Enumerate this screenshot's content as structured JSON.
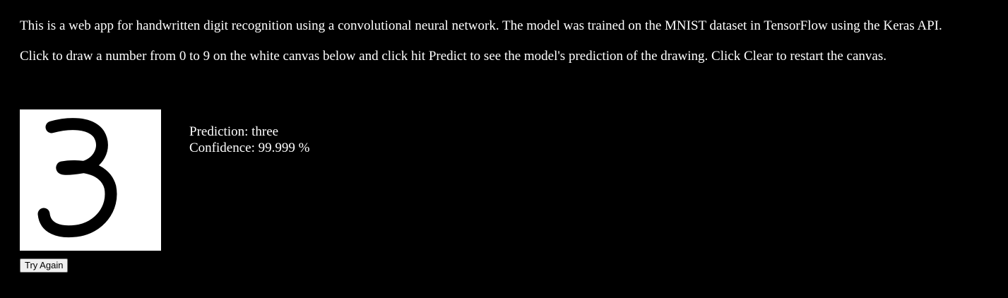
{
  "intro": {
    "line1": "This is a web app for handwritten digit recognition using a convolutional neural network. The model was trained on the MNIST dataset in TensorFlow using the Keras API.",
    "line2": "Click to draw a number from 0 to 9 on the white canvas below and click hit Predict to see the model's prediction of the drawing. Click Clear to restart the canvas."
  },
  "canvas": {
    "background": "#ffffff",
    "stroke_color": "#000000"
  },
  "prediction": {
    "label": "Prediction:",
    "value": "three"
  },
  "confidence": {
    "label": "Confidence:",
    "value": "99.999",
    "unit": "%"
  },
  "button": {
    "label": "Try Again"
  },
  "colors": {
    "page_background": "#000000",
    "text": "#ffffff"
  }
}
